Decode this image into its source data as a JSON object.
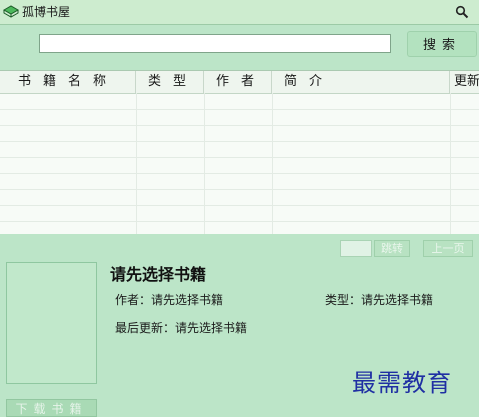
{
  "window": {
    "title": "孤博书屋"
  },
  "search": {
    "placeholder": "",
    "value": "",
    "button_label": "搜索"
  },
  "table": {
    "columns": [
      "书籍名称",
      "类型",
      "作者",
      "简介",
      "更新"
    ],
    "rows": []
  },
  "pagination": {
    "page_value": "",
    "jump_label": "跳转",
    "prev_label": "上一页"
  },
  "details": {
    "title": "请先选择书籍",
    "author_label": "作者：",
    "author_value": "请先选择书籍",
    "type_label": "类型：",
    "type_value": "请先选择书籍",
    "updated_label": "最后更新：",
    "updated_value": "请先选择书籍"
  },
  "download": {
    "label": "下载书籍"
  },
  "watermark": {
    "text": "最需教育"
  },
  "icons": {
    "app": "book-icon",
    "title_search": "magnifier-icon"
  },
  "colors": {
    "background": "#bce5c8",
    "table_bg": "#f7fbf7",
    "watermark": "#1f2fa3"
  }
}
